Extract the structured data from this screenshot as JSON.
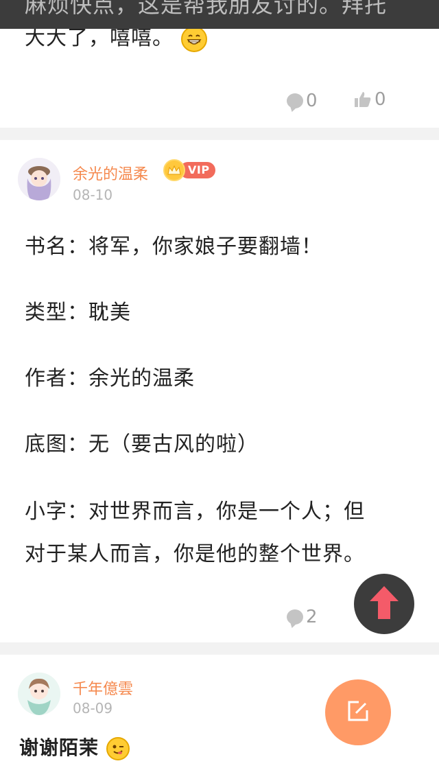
{
  "top_overlay": {
    "partial_text": "麻烦快点，这是帮我朋友讨的。拜托"
  },
  "post1": {
    "last_line": "大大了，嘻嘻。",
    "emoji": "grin-emoji",
    "comments": "0",
    "likes": "0"
  },
  "post2": {
    "username": "余光的温柔",
    "vip_label": "VIP",
    "date": "08-10",
    "lines": [
      "书名：将军，你家娘子要翻墙！",
      "类型：耽美",
      "作者：余光的温柔",
      "底图：无（要古风的啦）",
      "小字：对世界而言，你是一个人；但",
      "对于某人而言，你是他的整个世界。"
    ],
    "comments": "2"
  },
  "post3": {
    "username": "千年億雲",
    "date": "08-09",
    "text": "谢谢陌茉",
    "emoji": "wink-emoji"
  },
  "colors": {
    "accent": "#f5894e",
    "vip": "#f26b5b",
    "fab_edit": "#ff9a66",
    "fab_top_arrow": "#f45b69"
  },
  "icons": {
    "scroll_top": "arrow-up-icon",
    "compose": "edit-icon",
    "comment": "comment-icon",
    "like": "thumb-up-icon"
  }
}
